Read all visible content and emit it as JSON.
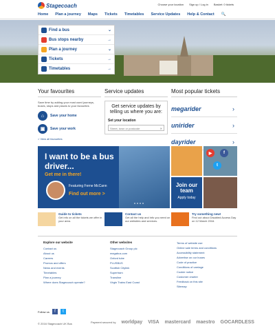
{
  "header": {
    "brand": "Stagecoach",
    "top_links": [
      "Choose your location",
      "Sign up / Log in",
      "Basket: 0 tickets"
    ],
    "nav": [
      "Home",
      "Plan a journey",
      "Maps",
      "Tickets",
      "Timetables",
      "Service Updates",
      "Help & Contact"
    ],
    "search_icon": "search-icon"
  },
  "quick_links": [
    {
      "label": "Find a bus",
      "icon": "bus-icon",
      "color": "#1d4f91"
    },
    {
      "label": "Bus stops nearby",
      "icon": "bus-stop-icon",
      "color": "#e43d30"
    },
    {
      "label": "Plan a journey",
      "icon": "map-pin-icon",
      "color": "#f5a623"
    },
    {
      "label": "Tickets",
      "icon": "ticket-icon",
      "color": "#1d4f91"
    },
    {
      "label": "Timetables",
      "icon": "timetable-icon",
      "color": "#1d4f91"
    }
  ],
  "favourites": {
    "title": "Your favourites",
    "text": "Save time by adding your most used journeys, buses, stops and places to your favourites",
    "buttons": [
      "Save your home",
      "Save your work"
    ],
    "link": "> View all favourites"
  },
  "service_updates": {
    "title": "Service updates",
    "box_title": "Get service updates by telling us where you are:",
    "label": "Set your location",
    "placeholder": "Street, town or postcode"
  },
  "popular_tickets": {
    "title": "Most popular tickets",
    "items": [
      "megarider",
      "unirider",
      "dayrider"
    ]
  },
  "promo": {
    "heading": "I want to be a bus driver...",
    "subheading": "Get me in there!",
    "featuring": "Featuring Ferne McCann",
    "cta": "Find out more >"
  },
  "join": {
    "title": "Join our team",
    "sub": "Apply today"
  },
  "info": [
    {
      "title": "Guide to tickets",
      "text": "Get info on all the tickets we offer in your area."
    },
    {
      "title": "Contact us",
      "text": "Get all the help and info you need on our websites and services."
    },
    {
      "title": "Try something new!",
      "text": "Find out about Disabled Access Day on 12 March 2016."
    }
  ],
  "footer": {
    "col1": {
      "title": "Explore our website",
      "links": [
        "Contact us",
        "About us",
        "Careers",
        "Promos and offers",
        "News and events",
        "Timetables",
        "Plan a journey",
        "Where does Stagecoach operate?"
      ]
    },
    "col2": {
      "title": "Other websites",
      "links": [
        "Stagecoach Group plc",
        "megabus.com",
        "Oxford tube",
        "PLUSBUS",
        "Scottish Citylink",
        "Supertram",
        "Transline",
        "Virgin Trains East Coast"
      ]
    },
    "col3": {
      "title": "",
      "links": [
        "Terms of website use",
        "Online sale terms and conditions",
        "Accessibility statement",
        "Advertise on our buses",
        "Code of practice",
        "Conditions of carriage",
        "Cookie notice",
        "Customer charter",
        "Feedback on this site",
        "Sitemap"
      ]
    },
    "follow": "Follow us",
    "copyright": "© 2016 Stagecoach UK Bus",
    "payment_label": "Payment secured by",
    "payments": [
      "worldpay",
      "VISA",
      "mastercard",
      "maestro",
      "GOCARDLESS"
    ]
  }
}
